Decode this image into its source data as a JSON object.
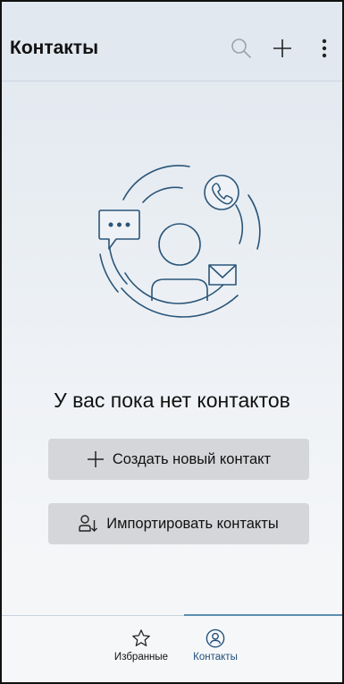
{
  "app": {
    "title": "Контакты"
  },
  "toolbar": {
    "search_icon": "search-icon",
    "add_icon": "plus-icon",
    "more_icon": "more-vertical-icon"
  },
  "empty_state": {
    "title": "У вас пока нет контактов",
    "illustration_icons": [
      "person-icon",
      "chat-bubble-icon",
      "phone-icon",
      "mail-icon"
    ]
  },
  "actions": {
    "create_label": "Создать новый контакт",
    "import_label": "Импортировать контакты"
  },
  "bottom_nav": {
    "items": [
      {
        "label": "Избранные",
        "icon": "star-icon",
        "selected": false
      },
      {
        "label": "Контакты",
        "icon": "contact-circle-icon",
        "selected": true
      }
    ]
  },
  "colors": {
    "accent": "#1f4e7a",
    "illustration_stroke": "#2a5578",
    "button_bg": "#d4d6d9",
    "appbar_bg": "#e2e8ef"
  }
}
